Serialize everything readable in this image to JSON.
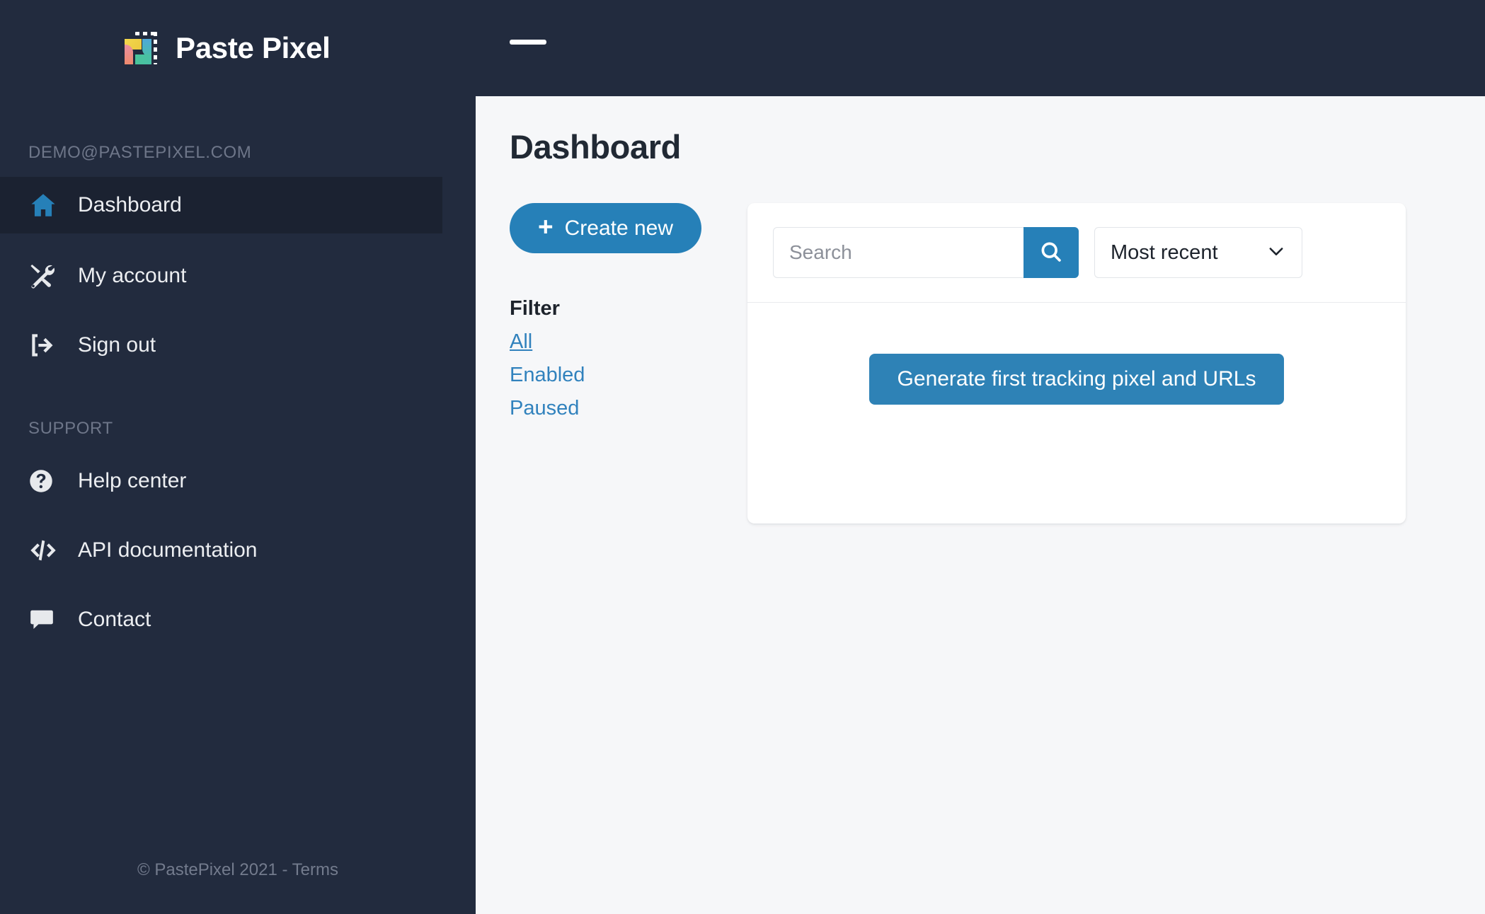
{
  "brand": {
    "name": "Paste Pixel",
    "logo_icon": "pastepixel-logo-icon"
  },
  "sidebar": {
    "account_label": "DEMO@PASTEPIXEL.COM",
    "support_label": "SUPPORT",
    "nav_primary": [
      {
        "label": "Dashboard",
        "icon": "home-icon",
        "active": true
      },
      {
        "label": "My account",
        "icon": "tools-icon",
        "active": false
      },
      {
        "label": "Sign out",
        "icon": "sign-out-icon",
        "active": false
      }
    ],
    "nav_support": [
      {
        "label": "Help center",
        "icon": "question-circle-icon"
      },
      {
        "label": "API documentation",
        "icon": "code-icon"
      },
      {
        "label": "Contact",
        "icon": "chat-bubble-icon"
      }
    ],
    "footer": "© PastePixel 2021 - Terms"
  },
  "topbar": {
    "menu_toggle_icon": "menu-icon"
  },
  "main": {
    "page_title": "Dashboard",
    "create_button": {
      "label": "Create new",
      "plus_icon": "plus-icon"
    },
    "filter": {
      "heading": "Filter",
      "options": [
        {
          "label": "All",
          "active": true
        },
        {
          "label": "Enabled",
          "active": false
        },
        {
          "label": "Paused",
          "active": false
        }
      ]
    },
    "card": {
      "search": {
        "placeholder": "Search",
        "value": "",
        "button_icon": "search-icon"
      },
      "sort": {
        "selected": "Most recent",
        "chevron_icon": "chevron-down-icon"
      },
      "empty_state": {
        "action_label": "Generate first tracking pixel and URLs"
      }
    }
  },
  "colors": {
    "sidebar_bg": "#222b3e",
    "sidebar_active_bg": "#1b2231",
    "accent_blue": "#2680b8",
    "link_blue": "#3182bd",
    "page_bg": "#f6f7f9",
    "card_bg": "#ffffff"
  }
}
